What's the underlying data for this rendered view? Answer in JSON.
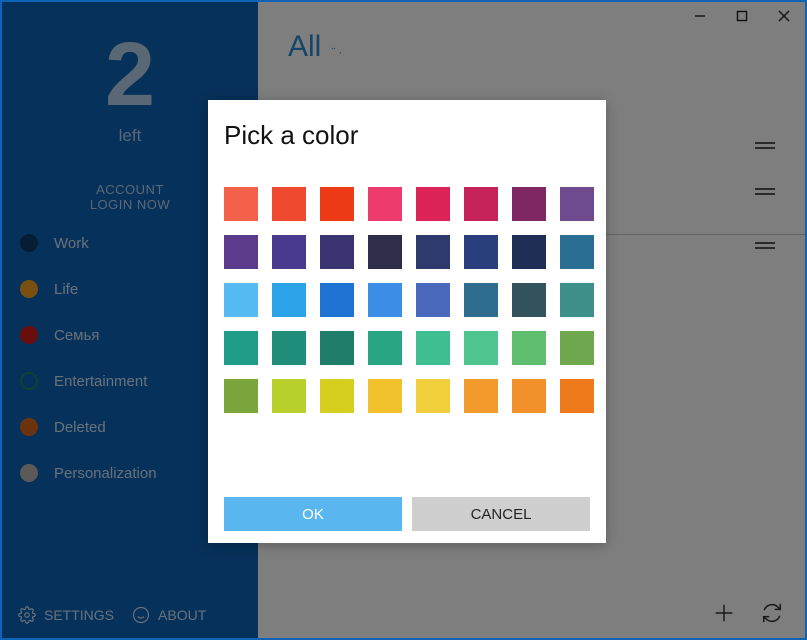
{
  "sidebar": {
    "counter_value": "2",
    "counter_label": "left",
    "account_label": "ACCOUNT",
    "login_label": "LOGIN NOW",
    "items": [
      {
        "label": "Work",
        "color": "#0b3c6a"
      },
      {
        "label": "Life",
        "color": "#f3a021"
      },
      {
        "label": "Семья",
        "color": "#d41a1a"
      },
      {
        "label": "Entertainment",
        "color": "#17886e"
      },
      {
        "label": "Deleted",
        "color": "#d7691e"
      },
      {
        "label": "Personalization",
        "color": "#b9b2b2"
      }
    ],
    "settings_label": "SETTINGS",
    "about_label": "ABOUT"
  },
  "main": {
    "title": "All",
    "menu_dots": "¨·"
  },
  "dialog": {
    "title": "Pick a color",
    "ok_label": "OK",
    "cancel_label": "CANCEL",
    "colors": [
      "#f3614a",
      "#ef4a2f",
      "#ed3b18",
      "#ef3b6c",
      "#db2455",
      "#c6225a",
      "#7e2763",
      "#6e4a8f",
      "#5d3b8c",
      "#4a3a8f",
      "#3a3371",
      "#2e2e4a",
      "#2d3a6b",
      "#2a3f7e",
      "#1f2e55",
      "#2a6f93",
      "#56bbf2",
      "#2da4ea",
      "#1d72d2",
      "#3c8de6",
      "#4a69bd",
      "#2f6d8e",
      "#33535f",
      "#3f8f8b",
      "#1f9d88",
      "#1f8d7a",
      "#1f7d6a",
      "#2aa583",
      "#3fbf8f",
      "#4fc48f",
      "#5fbf6f",
      "#6fa84f",
      "#7aa53c",
      "#b8cf2c",
      "#d6cf20",
      "#f2c22c",
      "#f2d03c",
      "#f29a2c",
      "#f2902c",
      "#ef7a1c"
    ]
  }
}
